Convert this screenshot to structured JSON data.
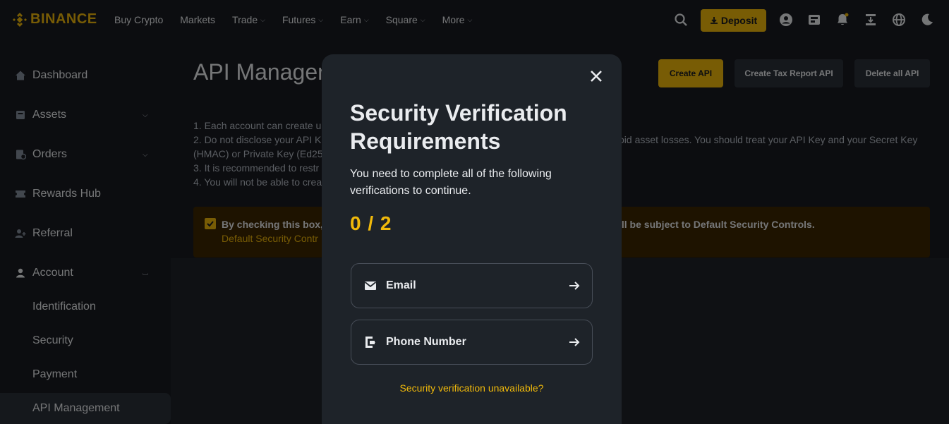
{
  "brand": {
    "name": "BINANCE",
    "color": "#f0b90b"
  },
  "nav": {
    "links": [
      {
        "label": "Buy Crypto",
        "has_dropdown": false
      },
      {
        "label": "Markets",
        "has_dropdown": false
      },
      {
        "label": "Trade",
        "has_dropdown": true
      },
      {
        "label": "Futures",
        "has_dropdown": true
      },
      {
        "label": "Earn",
        "has_dropdown": true
      },
      {
        "label": "Square",
        "has_dropdown": true
      },
      {
        "label": "More",
        "has_dropdown": true
      }
    ],
    "deposit_label": "Deposit",
    "right_icons": [
      "search-icon",
      "user-icon",
      "wallet-icon",
      "notification-bell-icon",
      "download-icon",
      "globe-icon",
      "theme-moon-icon"
    ]
  },
  "sidebar": {
    "items": [
      {
        "label": "Dashboard",
        "icon": "home-icon"
      },
      {
        "label": "Assets",
        "icon": "wallet-icon",
        "expand": "down"
      },
      {
        "label": "Orders",
        "icon": "orders-icon",
        "expand": "down"
      },
      {
        "label": "Rewards Hub",
        "icon": "ticket-icon"
      },
      {
        "label": "Referral",
        "icon": "user-add-icon"
      },
      {
        "label": "Account",
        "icon": "user-icon",
        "expand": "up"
      }
    ],
    "sub_items": [
      {
        "label": "Identification"
      },
      {
        "label": "Security"
      },
      {
        "label": "Payment"
      },
      {
        "label": "API Management",
        "active": true
      }
    ]
  },
  "main": {
    "title": "API Managen",
    "buttons": {
      "create": "Create API",
      "tax": "Create Tax Report API",
      "delete": "Delete all API"
    },
    "notes": [
      "1. Each account can create up",
      "2. Do not disclose your API Ke",
      "(HMAC) or Private Key (Ed255",
      "3. It is recommended to restr",
      "4. You will not be able to crea"
    ],
    "note_right": "oid asset losses. You should treat your API Key and your Secret Key",
    "warning": {
      "text": "By checking this box, a",
      "link": "Default Security Contr",
      "text_right": "ill be subject to Default Security Controls."
    }
  },
  "modal": {
    "title": "Security Verification Requirements",
    "subtitle": "You need to complete all of the following verifications to continue.",
    "progress": "0 / 2",
    "progress_completed": 0,
    "progress_total": 2,
    "items": [
      {
        "label": "Email",
        "icon": "email-icon"
      },
      {
        "label": "Phone Number",
        "icon": "phone-icon"
      }
    ],
    "link": "Security verification unavailable?"
  }
}
